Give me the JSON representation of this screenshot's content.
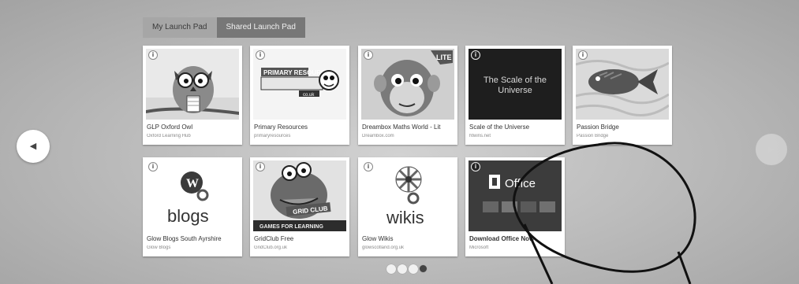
{
  "tabs": [
    {
      "label": "My Launch Pad",
      "active": false
    },
    {
      "label": "Shared Launch Pad",
      "active": true
    }
  ],
  "nav": {
    "prev_icon": "chevron-left-icon",
    "next_icon": "chevron-right-icon"
  },
  "cards": [
    {
      "title": "GLP Oxford Owl",
      "subtitle": "Oxford Learning Hub",
      "thumb_text": ""
    },
    {
      "title": "Primary Resources",
      "subtitle": "primaryresources",
      "thumb_text": "PRIMARY RESOURCES",
      "thumb_sub": "co.uk"
    },
    {
      "title": "Dreambox Maths World - Lit",
      "subtitle": "Dreambox.com",
      "thumb_text": "LITE"
    },
    {
      "title": "Scale of the Universe",
      "subtitle": "htwins.net",
      "thumb_text": "The Scale of the Universe"
    },
    {
      "title": "Passion Bridge",
      "subtitle": "Passion Bridge",
      "thumb_text": ""
    },
    {
      "title": "Glow Blogs South Ayrshire",
      "subtitle": "Glow Blogs",
      "thumb_text": "blogs"
    },
    {
      "title": "GridClub Free",
      "subtitle": "GridClub.org.uk",
      "thumb_text": "GRID CLUB",
      "thumb_sub": "GAMES FOR LEARNING"
    },
    {
      "title": "Glow Wikis",
      "subtitle": "glowscotland.org.uk",
      "thumb_text": "wikis"
    },
    {
      "title": "Download Office Now",
      "subtitle": "Microsoft",
      "thumb_text": "Office"
    }
  ],
  "pager": {
    "count": 4,
    "active_index": 3
  },
  "colors": {
    "tab_active": "#777777",
    "card_bg": "#ffffff",
    "annotation": "#111111"
  }
}
